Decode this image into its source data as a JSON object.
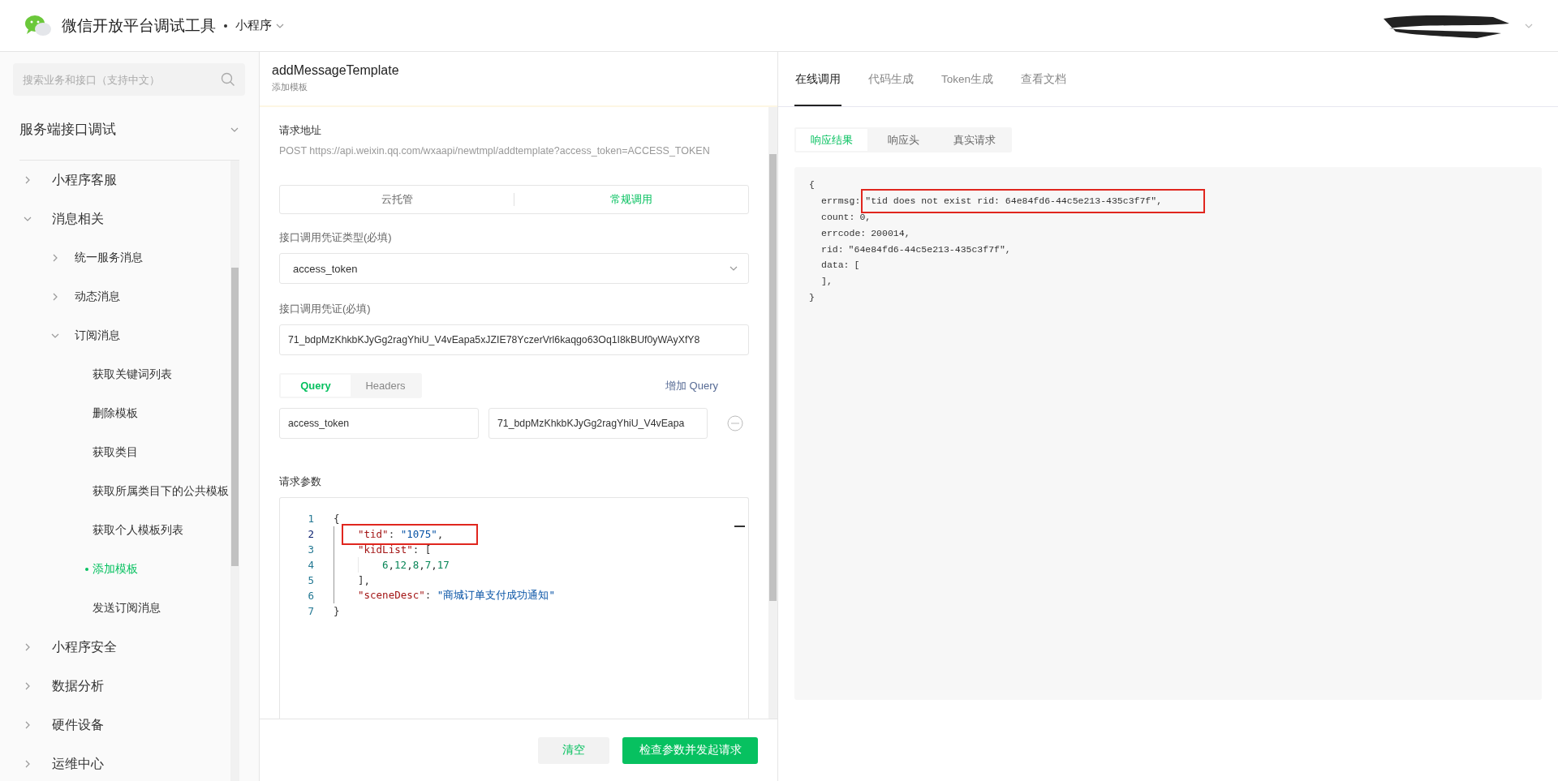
{
  "header": {
    "title": "微信开放平台调试工具",
    "product": "小程序"
  },
  "sidebar": {
    "search": {
      "placeholder": "搜索业务和接口（支持中文）"
    },
    "section": {
      "label": "服务端接口调试",
      "expanded": true
    },
    "tree": [
      {
        "label": "小程序客服",
        "expanded": false,
        "selected": false
      },
      {
        "label": "消息相关",
        "expanded": true,
        "selected": false,
        "children": [
          {
            "label": "统一服务消息",
            "expanded": false,
            "selected": false
          },
          {
            "label": "动态消息",
            "expanded": false,
            "selected": false
          },
          {
            "label": "订阅消息",
            "expanded": true,
            "selected": false,
            "children": [
              {
                "label": "获取关键词列表",
                "selected": false
              },
              {
                "label": "删除模板",
                "selected": false
              },
              {
                "label": "获取类目",
                "selected": false
              },
              {
                "label": "获取所属类目下的公共模板",
                "selected": false
              },
              {
                "label": "获取个人模板列表",
                "selected": false
              },
              {
                "label": "添加模板",
                "selected": true
              },
              {
                "label": "发送订阅消息",
                "selected": false
              }
            ]
          }
        ]
      },
      {
        "label": "小程序安全",
        "expanded": false,
        "selected": false
      },
      {
        "label": "数据分析",
        "expanded": false,
        "selected": false
      },
      {
        "label": "硬件设备",
        "expanded": false,
        "selected": false
      },
      {
        "label": "运维中心",
        "expanded": false,
        "selected": false
      }
    ]
  },
  "request": {
    "title": "addMessageTemplate",
    "subtitle": "添加模板",
    "url_label": "请求地址",
    "url": "POST https://api.weixin.qq.com/wxaapi/newtmpl/addtemplate?access_token=ACCESS_TOKEN",
    "modes": [
      {
        "label": "云托管",
        "selected": false
      },
      {
        "label": "常规调用",
        "selected": true
      }
    ],
    "credential_type": {
      "label": "接口调用凭证类型(必填)",
      "value": "access_token"
    },
    "credential": {
      "label": "接口调用凭证(必填)",
      "value": "71_bdpMzKhkbKJyGg2ragYhiU_V4vEapa5xJZIE78YczerVrl6kaqgo63Oq1I8kBUf0yWAyXfY8"
    },
    "param_tabs": [
      {
        "label": "Query",
        "selected": true
      },
      {
        "label": "Headers",
        "selected": false
      }
    ],
    "add_query": "增加 Query",
    "query_rows": [
      {
        "key": "access_token",
        "value": "71_bdpMzKhkbKJyGg2ragYhiU_V4vEapa"
      }
    ],
    "params_label": "请求参数",
    "code": [
      {
        "number": "1",
        "highlighted": false,
        "tokens": [
          {
            "kind": "punct",
            "text": "{"
          }
        ]
      },
      {
        "number": "2",
        "highlighted": true,
        "tokens": [
          {
            "kind": "key",
            "text": "\"tid\""
          },
          {
            "kind": "punct",
            "text": ": "
          },
          {
            "kind": "string",
            "text": "\"1075\""
          },
          {
            "kind": "punct",
            "text": ","
          }
        ]
      },
      {
        "number": "3",
        "highlighted": false,
        "tokens": [
          {
            "kind": "key",
            "text": "\"kidList\""
          },
          {
            "kind": "punct",
            "text": ": ["
          }
        ]
      },
      {
        "number": "4",
        "highlighted": false,
        "tokens": [
          {
            "kind": "number",
            "text": "6"
          },
          {
            "kind": "punct",
            "text": ","
          },
          {
            "kind": "number",
            "text": "12"
          },
          {
            "kind": "punct",
            "text": ","
          },
          {
            "kind": "number",
            "text": "8"
          },
          {
            "kind": "punct",
            "text": ","
          },
          {
            "kind": "number",
            "text": "7"
          },
          {
            "kind": "punct",
            "text": ","
          },
          {
            "kind": "number",
            "text": "17"
          }
        ]
      },
      {
        "number": "5",
        "highlighted": false,
        "tokens": [
          {
            "kind": "punct",
            "text": "],"
          }
        ]
      },
      {
        "number": "6",
        "highlighted": false,
        "tokens": [
          {
            "kind": "key",
            "text": "\"sceneDesc\""
          },
          {
            "kind": "punct",
            "text": ": "
          },
          {
            "kind": "string",
            "text": "\"商城订单支付成功通知\""
          }
        ]
      },
      {
        "number": "7",
        "highlighted": false,
        "tokens": [
          {
            "kind": "punct",
            "text": "}"
          }
        ]
      }
    ],
    "buttons": [
      {
        "label": "清空",
        "kind": "secondary"
      },
      {
        "label": "检查参数并发起请求",
        "kind": "primary"
      }
    ]
  },
  "result": {
    "tabs": [
      {
        "label": "在线调用",
        "selected": true
      },
      {
        "label": "代码生成",
        "selected": false
      },
      {
        "label": "Token生成",
        "selected": false
      },
      {
        "label": "查看文档",
        "selected": false
      }
    ],
    "sub_tabs": [
      {
        "label": "响应结果",
        "selected": true
      },
      {
        "label": "响应头",
        "selected": false
      },
      {
        "label": "真实请求",
        "selected": false
      }
    ],
    "lines": [
      {
        "key": "{",
        "highlighted": false
      },
      {
        "key": "errmsg:",
        "value": "\"tid does not exist rid: 64e84fd6-44c5e213-435c3f7f\",",
        "highlighted": true
      },
      {
        "key": "count:",
        "value": "0,",
        "highlighted": false
      },
      {
        "key": "errcode:",
        "value": "200014,",
        "highlighted": false
      },
      {
        "key": "rid:",
        "value": "\"64e84fd6-44c5e213-435c3f7f\",",
        "highlighted": false
      },
      {
        "key": "data:",
        "value": "[",
        "highlighted": false
      },
      {
        "key": "],",
        "highlighted": false
      },
      {
        "key": "}",
        "highlighted": false
      }
    ]
  }
}
